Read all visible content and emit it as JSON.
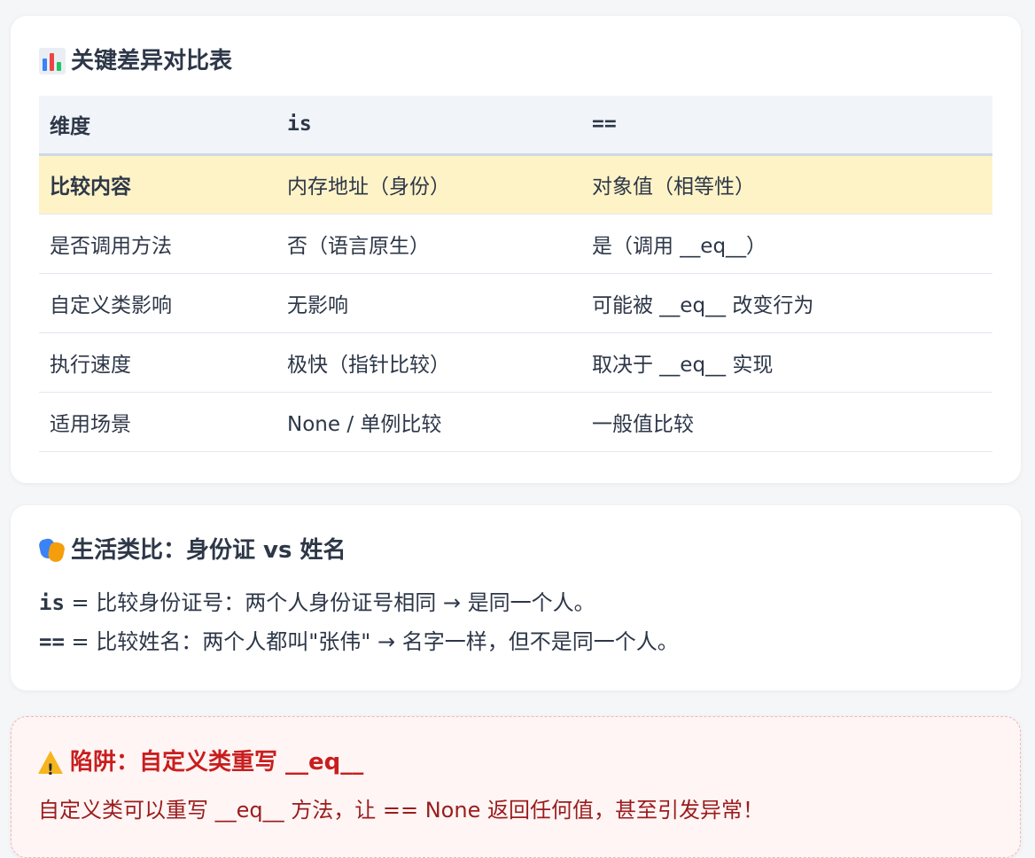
{
  "comparison": {
    "title": "关键差异对比表",
    "icon": "bar-chart-icon",
    "headers": [
      "维度",
      "is",
      "=="
    ],
    "rows": [
      [
        "比较内容",
        "内存地址（身份）",
        "对象值（相等性）"
      ],
      [
        "是否调用方法",
        "否（语言原生）",
        "是（调用 __eq__）"
      ],
      [
        "自定义类影响",
        "无影响",
        "可能被 __eq__ 改变行为"
      ],
      [
        "执行速度",
        "极快（指针比较）",
        "取决于 __eq__ 实现"
      ],
      [
        "适用场景",
        "None / 单例比较",
        "一般值比较"
      ]
    ],
    "highlight_color": "#fef3c7"
  },
  "analogy": {
    "title": "生活类比：身份证 vs 姓名",
    "icon": "theater-masks-icon",
    "line1_op": "is",
    "line1_text": " = 比较身份证号：两个人身份证号相同 → 是同一个人。",
    "line2_op": "==",
    "line2_text": " = 比较姓名：两个人都叫\"张伟\" → 名字一样，但不是同一个人。"
  },
  "warning": {
    "title": "陷阱：自定义类重写 __eq__",
    "icon": "warning-icon",
    "text": "自定义类可以重写 __eq__ 方法，让 == None 返回任何值，甚至引发异常！",
    "title_color": "#c81e1e"
  }
}
